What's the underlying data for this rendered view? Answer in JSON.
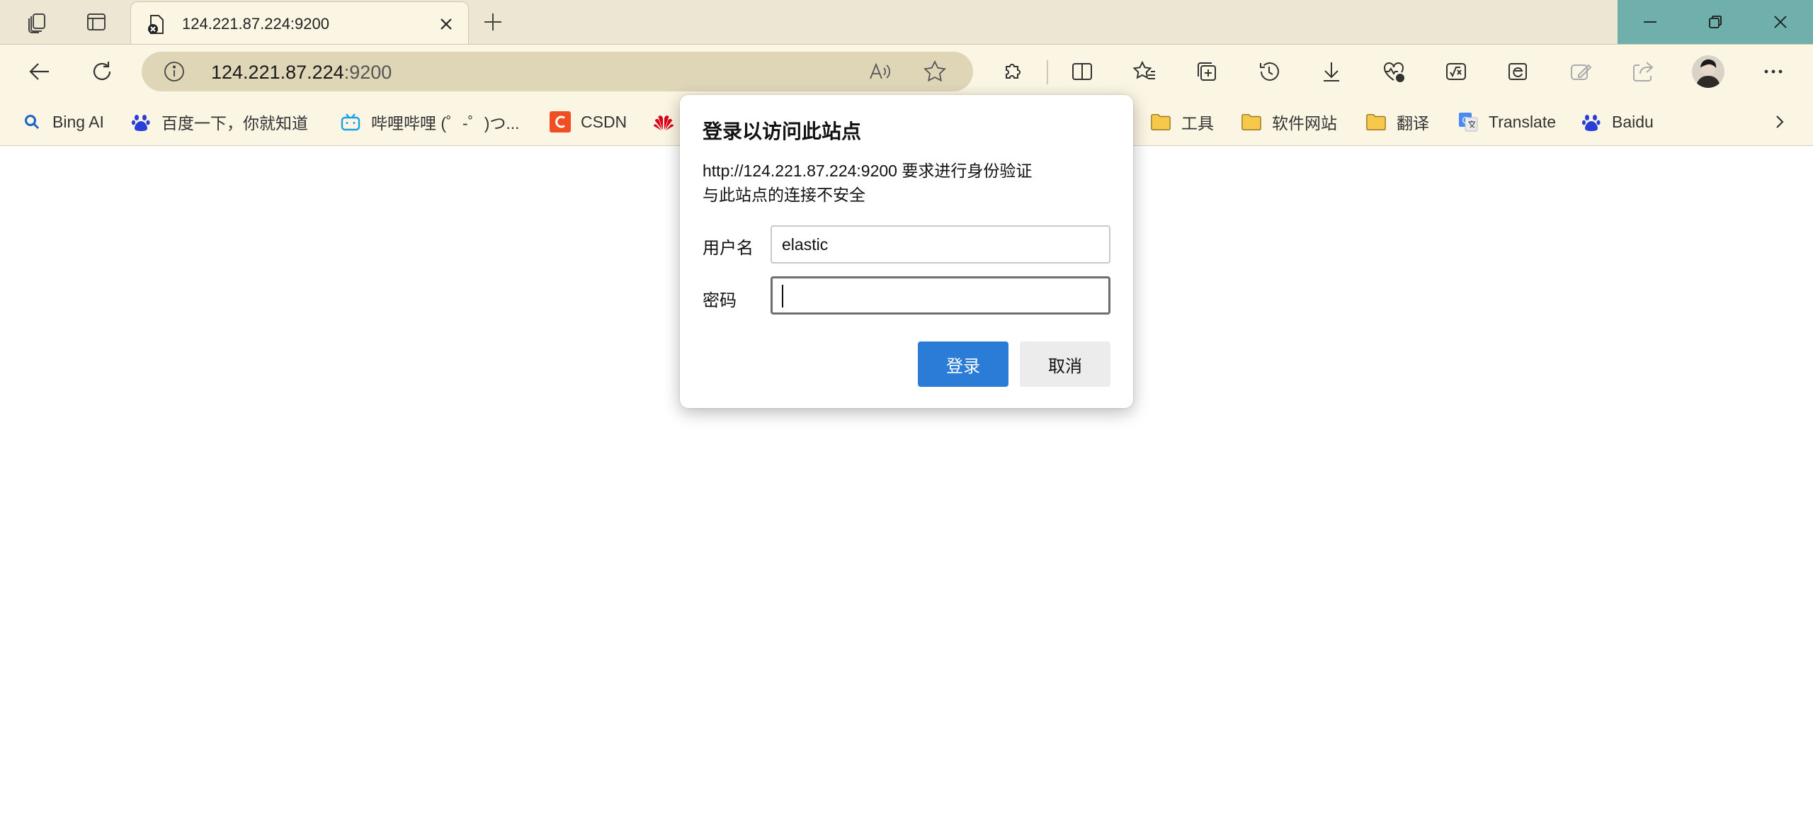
{
  "browser": {
    "tab": {
      "title": "124.221.87.224:9200"
    },
    "address": {
      "host": "124.221.87.224",
      "port": ":9200"
    }
  },
  "bookmarks": [
    {
      "label": "Bing AI",
      "icon": "search-icon"
    },
    {
      "label": "百度一下，你就知道",
      "icon": "baidu-paw-icon"
    },
    {
      "label": "哔哩哔哩 (゜-゜)つ...",
      "icon": "bilibili-icon"
    },
    {
      "label": "CSDN",
      "icon": "csdn-icon"
    },
    {
      "label": "",
      "icon": "huawei-icon"
    },
    {
      "label": "工具",
      "icon": "folder-icon"
    },
    {
      "label": "软件网站",
      "icon": "folder-icon"
    },
    {
      "label": "翻译",
      "icon": "folder-icon"
    },
    {
      "label": "Translate",
      "icon": "google-translate-icon"
    },
    {
      "label": "Baidu",
      "icon": "baidu-paw-icon"
    }
  ],
  "dialog": {
    "title": "登录以访问此站点",
    "message_line1": "http://124.221.87.224:9200 要求进行身份验证",
    "message_line2": "与此站点的连接不安全",
    "username_label": "用户名",
    "username_value": "elastic",
    "password_label": "密码",
    "password_value": "",
    "login_label": "登录",
    "cancel_label": "取消"
  },
  "colors": {
    "accent": "#2b7cd6",
    "chrome": "#fbf5e3",
    "tabstrip": "#ece6d2",
    "window_controls": "#6fb0ac"
  }
}
